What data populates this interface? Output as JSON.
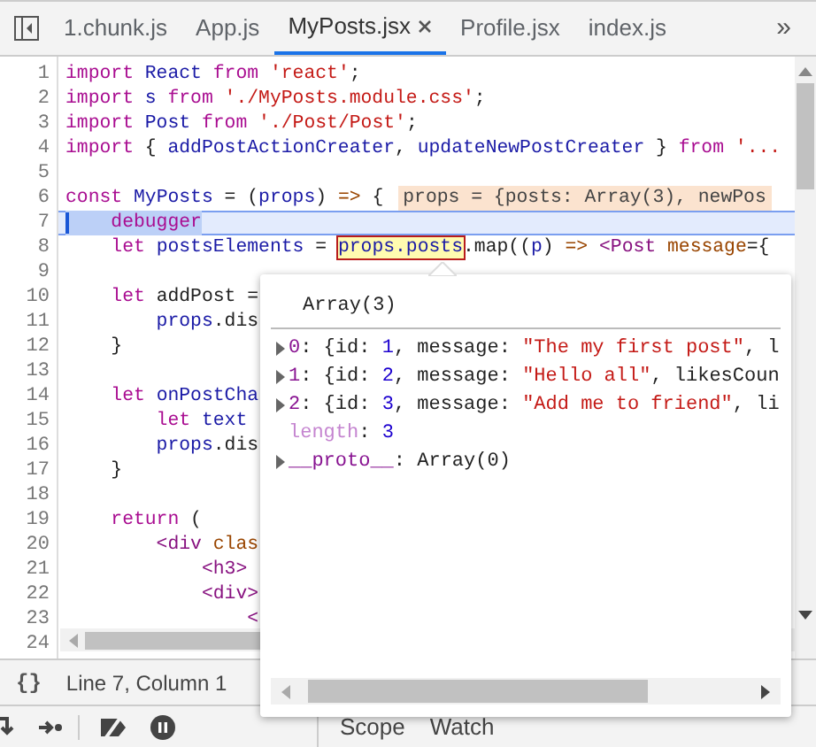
{
  "tabs": [
    {
      "label": "1.chunk.js",
      "selected": false,
      "closable": false
    },
    {
      "label": "App.js",
      "selected": false,
      "closable": false
    },
    {
      "label": "MyPosts.jsx",
      "selected": true,
      "closable": true
    },
    {
      "label": "Profile.jsx",
      "selected": false,
      "closable": false
    },
    {
      "label": "index.js",
      "selected": false,
      "closable": false
    }
  ],
  "tabs_more": "»",
  "editor": {
    "lines": [
      {
        "number": "1",
        "current": false,
        "tokens": [
          {
            "kind": "kw",
            "text": "import"
          },
          {
            "kind": "def",
            "text": " React"
          },
          {
            "kind": "kw",
            "text": " from"
          },
          {
            "kind": "str",
            "text": " 'react'"
          },
          {
            "kind": "p",
            "text": ";"
          }
        ]
      },
      {
        "number": "2",
        "current": false,
        "tokens": [
          {
            "kind": "kw",
            "text": "import"
          },
          {
            "kind": "def",
            "text": " s"
          },
          {
            "kind": "kw",
            "text": " from"
          },
          {
            "kind": "str",
            "text": " './MyPosts.module.css'"
          },
          {
            "kind": "p",
            "text": ";"
          }
        ]
      },
      {
        "number": "3",
        "current": false,
        "tokens": [
          {
            "kind": "kw",
            "text": "import"
          },
          {
            "kind": "def",
            "text": " Post"
          },
          {
            "kind": "kw",
            "text": " from"
          },
          {
            "kind": "str",
            "text": " './Post/Post'"
          },
          {
            "kind": "p",
            "text": ";"
          }
        ]
      },
      {
        "number": "4",
        "current": false,
        "tokens": [
          {
            "kind": "kw",
            "text": "import"
          },
          {
            "kind": "p",
            "text": " {"
          },
          {
            "kind": "def",
            "text": " addPostActionCreater"
          },
          {
            "kind": "p",
            "text": ","
          },
          {
            "kind": "def",
            "text": " updateNewPostCreater"
          },
          {
            "kind": "p",
            "text": " }"
          },
          {
            "kind": "kw",
            "text": " from"
          },
          {
            "kind": "str",
            "text": " '..."
          }
        ]
      },
      {
        "number": "5",
        "current": false
      },
      {
        "number": "6",
        "current": false,
        "tokens": [
          {
            "kind": "kw",
            "text": "const"
          },
          {
            "kind": "def",
            "text": " MyPosts"
          },
          {
            "kind": "p",
            "text": " = ("
          },
          {
            "kind": "def",
            "text": "props"
          },
          {
            "kind": "p",
            "text": ")"
          },
          {
            "kind": "op",
            "text": " =>"
          },
          {
            "kind": "p",
            "text": " {"
          }
        ],
        "inline_value": "props = {posts: Array(3), newPos"
      },
      {
        "number": "7",
        "current": true,
        "tokens": [
          {
            "kind": "kw",
            "text": "    debugger"
          }
        ]
      },
      {
        "number": "8",
        "current": false,
        "tokens": [
          {
            "kind": "kw",
            "text": "    let"
          },
          {
            "kind": "def",
            "text": " postsElements"
          },
          {
            "kind": "p",
            "text": " = "
          },
          {
            "kind": "hl",
            "text": "props.posts"
          },
          {
            "kind": "p",
            "text": ".map(("
          },
          {
            "kind": "def",
            "text": "p"
          },
          {
            "kind": "p",
            "text": ")"
          },
          {
            "kind": "op",
            "text": " =>"
          },
          {
            "kind": "tag",
            "text": " <Post"
          },
          {
            "kind": "attr",
            "text": " message"
          },
          {
            "kind": "p",
            "text": "={"
          }
        ]
      },
      {
        "number": "9",
        "current": false
      },
      {
        "number": "10",
        "current": false,
        "tokens": [
          {
            "kind": "kw",
            "text": "    let"
          },
          {
            "kind": "p",
            "text": " addPost ="
          }
        ]
      },
      {
        "number": "11",
        "current": false,
        "tokens": [
          {
            "kind": "def",
            "text": "        props"
          },
          {
            "kind": "p",
            "text": ".dis"
          }
        ]
      },
      {
        "number": "12",
        "current": false,
        "tokens": [
          {
            "kind": "p",
            "text": "    }"
          }
        ]
      },
      {
        "number": "13",
        "current": false
      },
      {
        "number": "14",
        "current": false,
        "tokens": [
          {
            "kind": "kw",
            "text": "    let"
          },
          {
            "kind": "def",
            "text": " onPostCha"
          }
        ]
      },
      {
        "number": "15",
        "current": false,
        "tokens": [
          {
            "kind": "kw",
            "text": "        let"
          },
          {
            "kind": "def",
            "text": " text"
          }
        ]
      },
      {
        "number": "16",
        "current": false,
        "tokens": [
          {
            "kind": "def",
            "text": "        props"
          },
          {
            "kind": "p",
            "text": ".dis"
          }
        ]
      },
      {
        "number": "17",
        "current": false,
        "tokens": [
          {
            "kind": "p",
            "text": "    }"
          }
        ]
      },
      {
        "number": "18",
        "current": false
      },
      {
        "number": "19",
        "current": false,
        "tokens": [
          {
            "kind": "kw",
            "text": "    return"
          },
          {
            "kind": "p",
            "text": " ("
          }
        ]
      },
      {
        "number": "20",
        "current": false,
        "tokens": [
          {
            "kind": "tag",
            "text": "        <div"
          },
          {
            "kind": "attr",
            "text": " clas"
          }
        ]
      },
      {
        "number": "21",
        "current": false,
        "tokens": [
          {
            "kind": "tag",
            "text": "            <h3>"
          }
        ]
      },
      {
        "number": "22",
        "current": false,
        "tokens": [
          {
            "kind": "tag",
            "text": "            <div>"
          }
        ]
      },
      {
        "number": "23",
        "current": false,
        "tokens": [
          {
            "kind": "tag",
            "text": "                <"
          }
        ]
      },
      {
        "number": "24",
        "current": false
      }
    ]
  },
  "popover": {
    "title": "Array(3)",
    "rows": [
      {
        "expandable": true,
        "tokens": [
          {
            "kind": "key",
            "text": "0"
          },
          {
            "kind": "p",
            "text": ": {id: "
          },
          {
            "kind": "num",
            "text": "1"
          },
          {
            "kind": "p",
            "text": ", message: "
          },
          {
            "kind": "str",
            "text": "\"The my first post\""
          },
          {
            "kind": "p",
            "text": ", l"
          }
        ]
      },
      {
        "expandable": true,
        "tokens": [
          {
            "kind": "key",
            "text": "1"
          },
          {
            "kind": "p",
            "text": ": {id: "
          },
          {
            "kind": "num",
            "text": "2"
          },
          {
            "kind": "p",
            "text": ", message: "
          },
          {
            "kind": "str",
            "text": "\"Hello all\""
          },
          {
            "kind": "p",
            "text": ", likesCoun"
          }
        ]
      },
      {
        "expandable": true,
        "tokens": [
          {
            "kind": "key",
            "text": "2"
          },
          {
            "kind": "p",
            "text": ": {id: "
          },
          {
            "kind": "num",
            "text": "3"
          },
          {
            "kind": "p",
            "text": ", message: "
          },
          {
            "kind": "str",
            "text": "\"Add me to friend\""
          },
          {
            "kind": "p",
            "text": ", li"
          }
        ]
      },
      {
        "expandable": false,
        "tokens": [
          {
            "kind": "dim",
            "text": "length"
          },
          {
            "kind": "p",
            "text": ": "
          },
          {
            "kind": "num",
            "text": "3"
          }
        ]
      },
      {
        "expandable": true,
        "tokens": [
          {
            "kind": "key",
            "text": "__proto__"
          },
          {
            "kind": "p",
            "text": ": Array(0)"
          }
        ]
      }
    ]
  },
  "status_bar": {
    "format_icon": "{}",
    "position": "Line 7, Column 1"
  },
  "sidebar_tabs": [
    {
      "label": "Scope",
      "selected": false
    },
    {
      "label": "Watch",
      "selected": false
    }
  ]
}
